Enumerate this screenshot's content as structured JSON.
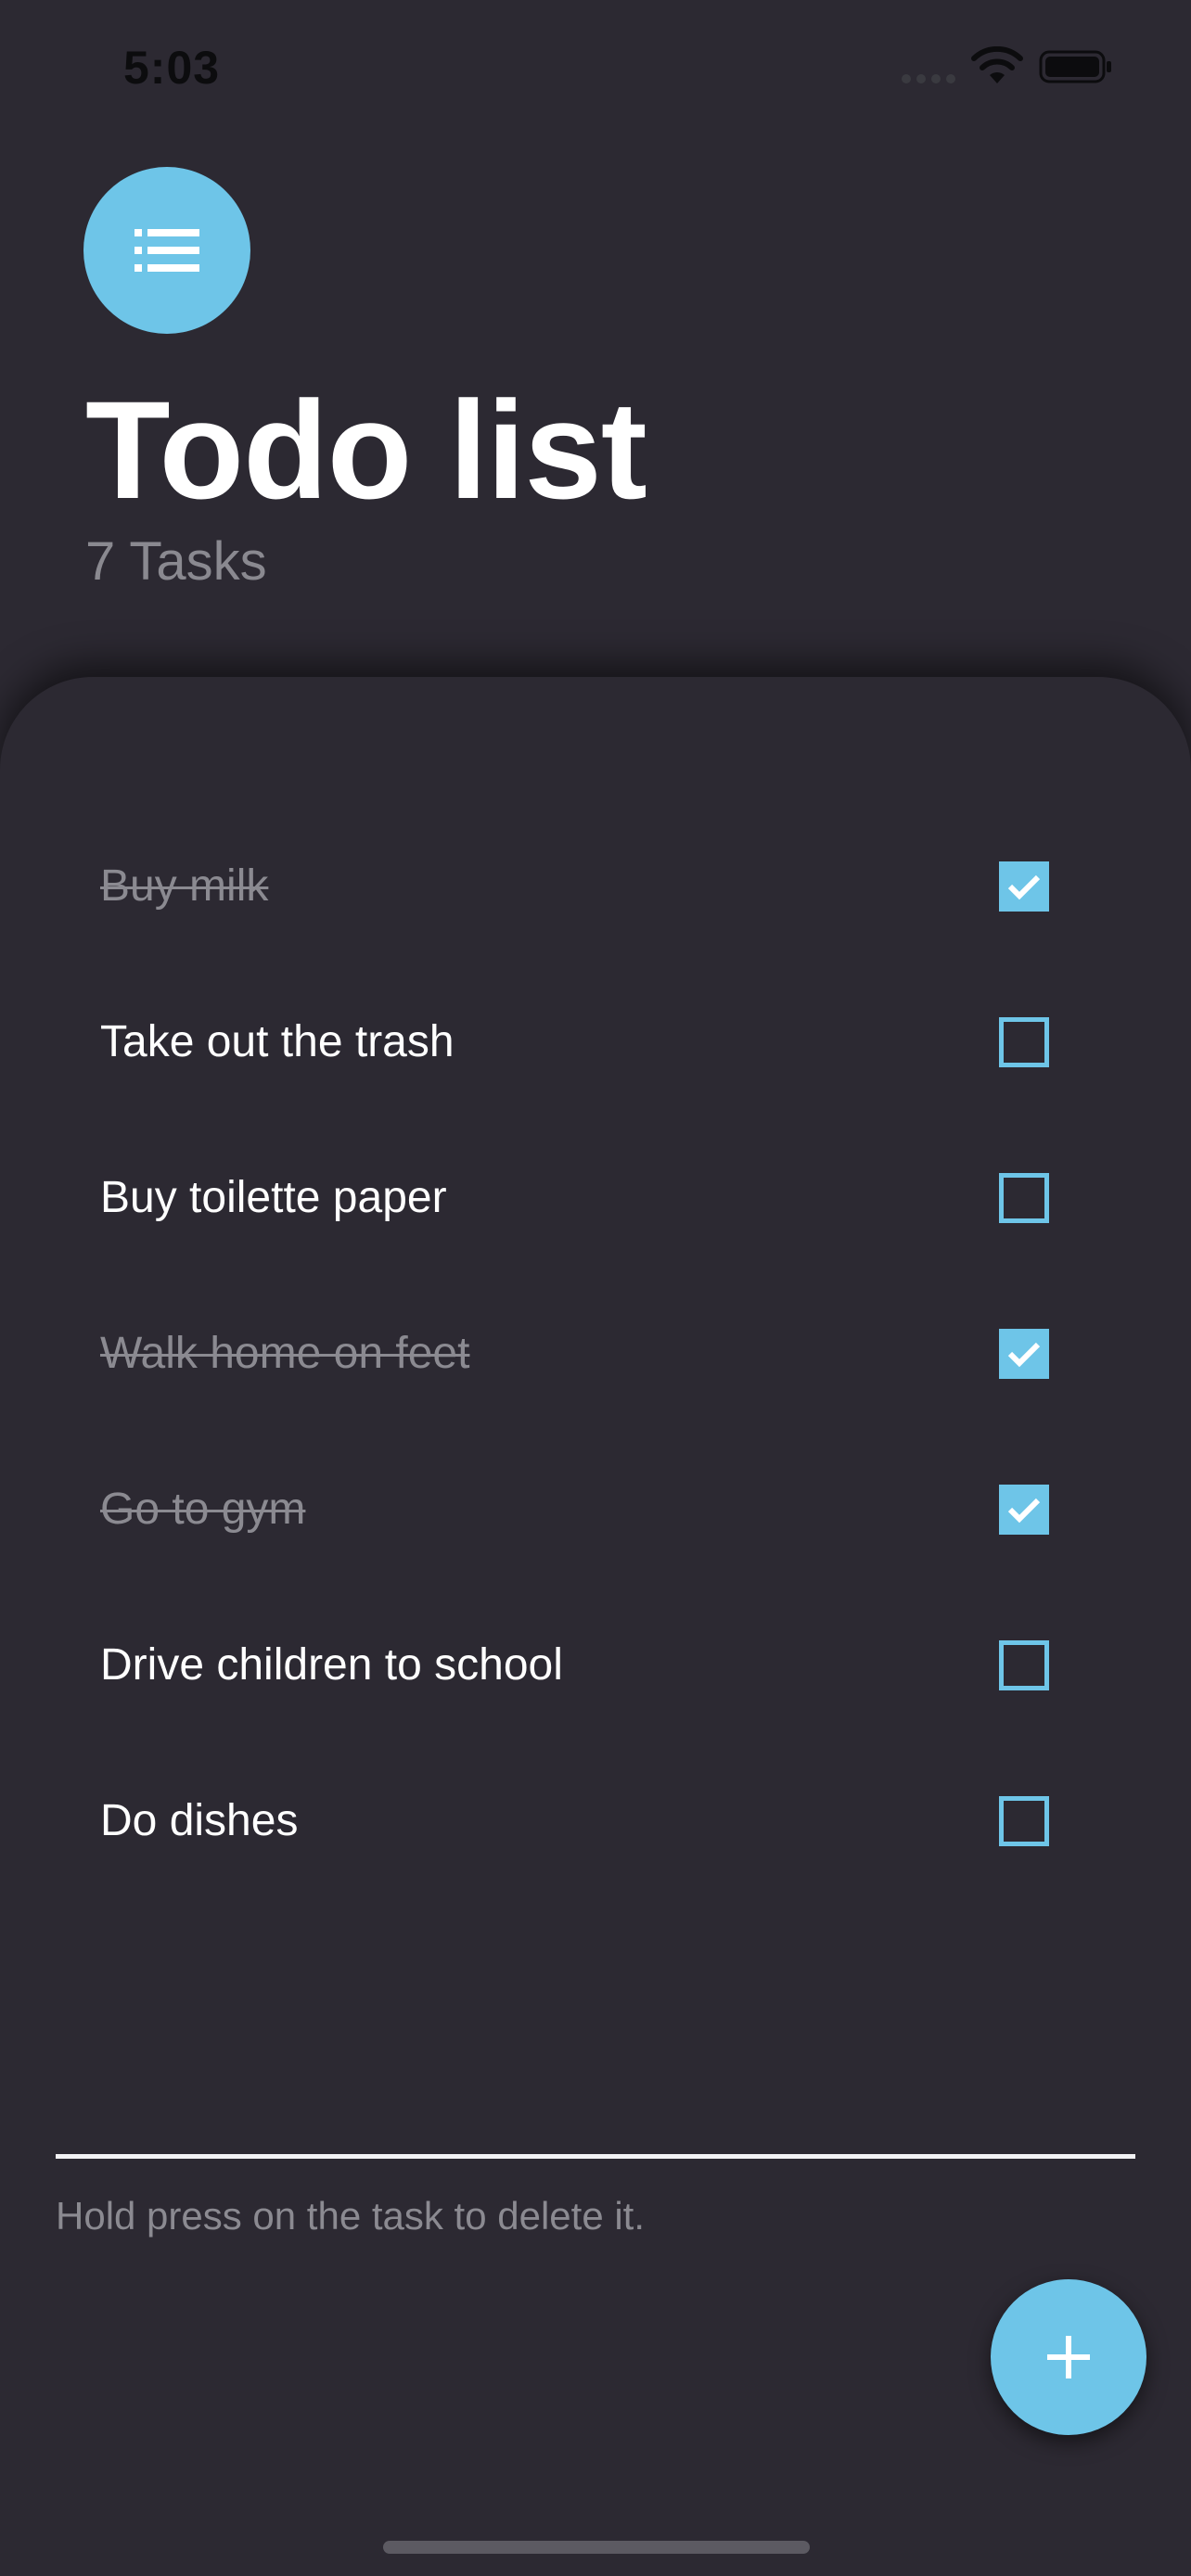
{
  "status_bar": {
    "time": "5:03",
    "icons": [
      "signal-dots-icon",
      "wifi-icon",
      "battery-icon"
    ]
  },
  "header": {
    "menu_icon": "list-icon",
    "title": "Todo list",
    "task_count": "7 Tasks"
  },
  "tasks": [
    {
      "label": "Buy milk",
      "done": true
    },
    {
      "label": "Take out the trash",
      "done": false
    },
    {
      "label": "Buy toilette paper",
      "done": false
    },
    {
      "label": "Walk home on feet",
      "done": true
    },
    {
      "label": "Go to gym",
      "done": true
    },
    {
      "label": "Drive children to school",
      "done": false
    },
    {
      "label": "Do dishes",
      "done": false
    }
  ],
  "footer": {
    "hint": "Hold press on the task to delete it.",
    "add_icon": "plus-icon"
  },
  "colors": {
    "background": "#2c2932",
    "accent": "#6ec5e8",
    "text_primary": "#ffffff",
    "text_muted": "#8b8a91"
  }
}
